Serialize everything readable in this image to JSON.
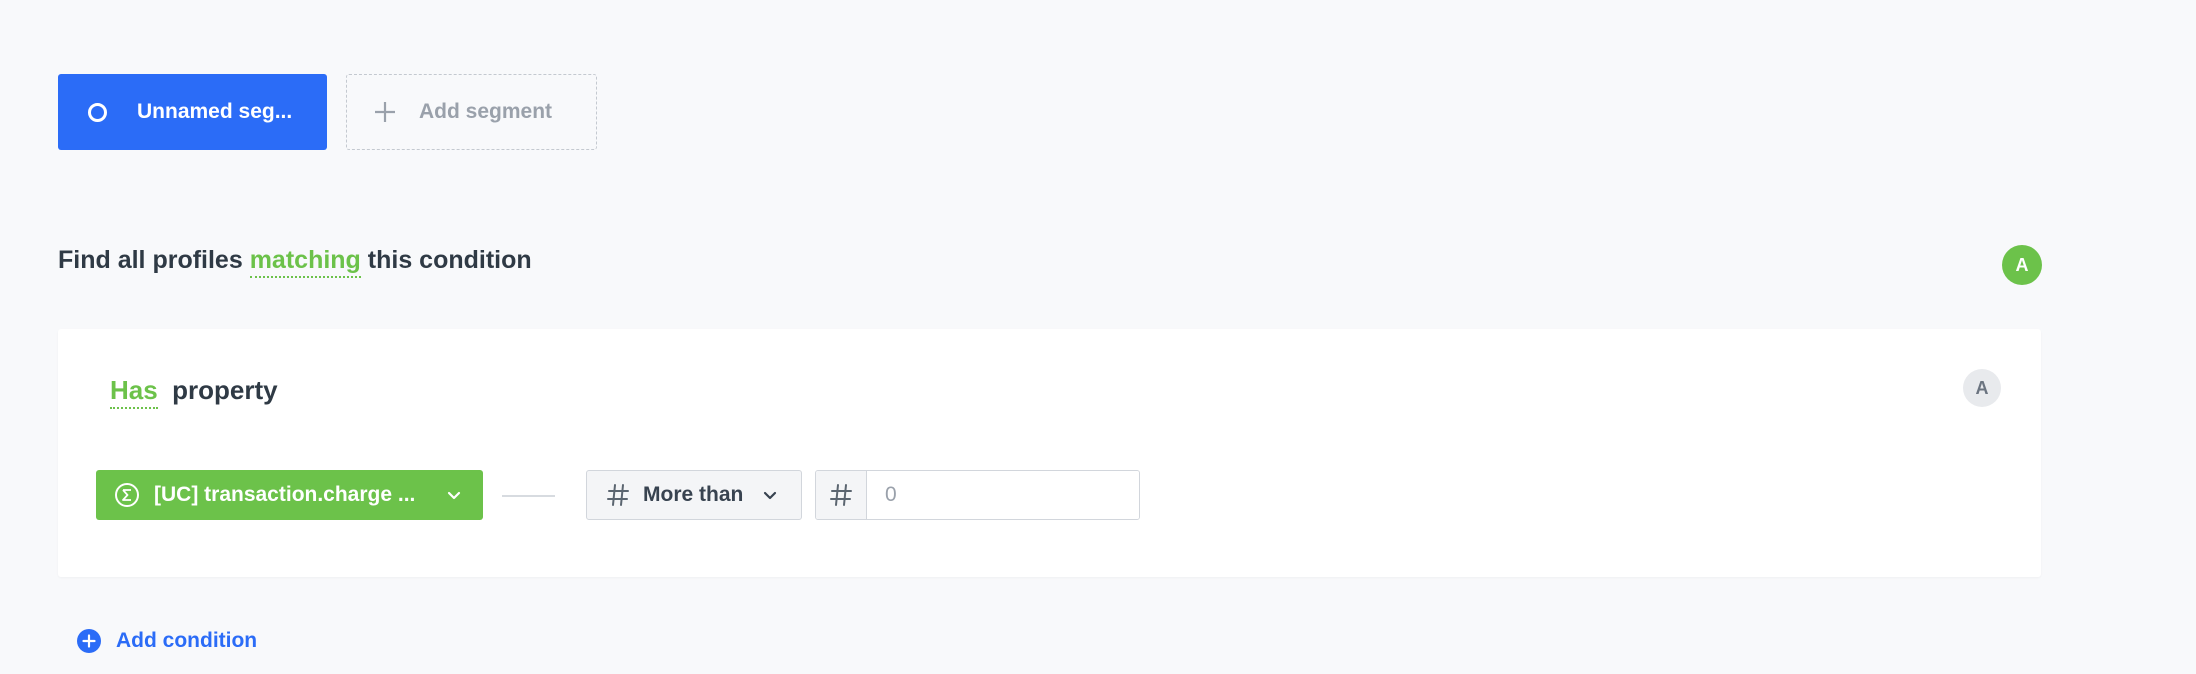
{
  "segments": {
    "active_label": "Unnamed seg...",
    "add_label": "Add segment"
  },
  "heading": {
    "prefix": "Find all profiles",
    "mode": "matching",
    "suffix": "this condition"
  },
  "badges": {
    "segment_letter": "A",
    "condition_letter": "A"
  },
  "condition": {
    "operator_has": "Has",
    "type": "property",
    "property_label": "[UC] transaction.charge ...",
    "comparison_label": "More than",
    "value_placeholder": "0",
    "value": ""
  },
  "add_condition_label": "Add condition",
  "colors": {
    "primary": "#2b6cf7",
    "success": "#6cc24a",
    "background": "#f8f9fb"
  },
  "icons": {
    "segment_status": "ring-icon",
    "add_segment": "plus-icon",
    "property_aggregate": "sigma-icon",
    "dropdown": "chevron-down-icon",
    "number_type": "hash-icon",
    "add_condition": "plus-circle-icon"
  }
}
